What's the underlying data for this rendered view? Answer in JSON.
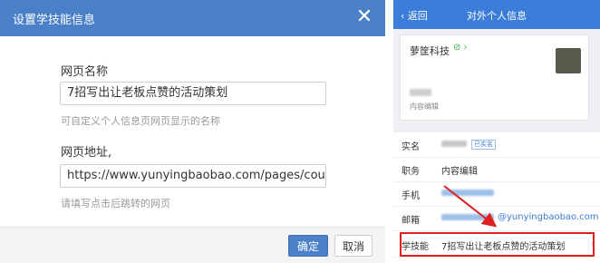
{
  "dialog": {
    "title": "设置学技能信息",
    "close_icon": "close-icon",
    "page_name_label": "网页名称",
    "page_name_value": "7招写出让老板点赞的活动策划",
    "page_name_hint": "可自定义个人信息页网页显示的名称",
    "page_url_label": "网页地址,",
    "page_url_value": "https://www.yunyingbaobao.com/pages/course.html?",
    "page_url_hint": "请填写点击后跳转的网页",
    "ok_label": "确定",
    "cancel_label": "取消",
    "accent_color": "#4a80c8"
  },
  "phone": {
    "back_label": "返回",
    "nav_title": "对外个人信息",
    "company": "萝筐科技",
    "verified_icon": "verified-check-icon",
    "role": "内容编辑",
    "rows": [
      {
        "key": "实名",
        "tag": "已实名"
      },
      {
        "key": "职务",
        "value": "内容编辑"
      },
      {
        "key": "手机"
      },
      {
        "key": "邮箱",
        "value": "@yunyingbaobao.com"
      },
      {
        "key": "学技能",
        "value": "7招写出让老板点赞的活动策划"
      }
    ],
    "nav_color": "#3b7dd8",
    "highlight_color": "#e02020"
  }
}
